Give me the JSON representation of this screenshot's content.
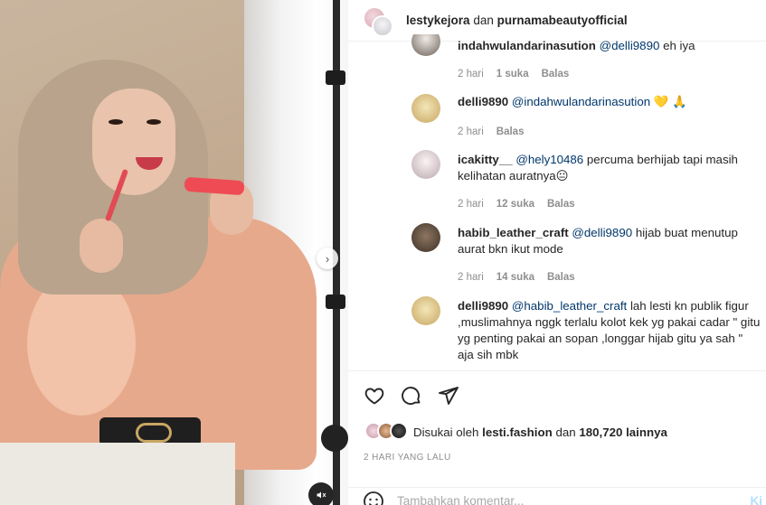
{
  "header": {
    "user1": "lestykejora",
    "conj": "dan",
    "user2": "purnamabeautyofficial"
  },
  "comments": [
    {
      "user": "indahwulandarinasution",
      "mention": "@delli9890",
      "text": "eh iya",
      "meta": {
        "time": "2 hari",
        "likes": "1 suka",
        "reply": "Balas"
      }
    },
    {
      "user": "delli9890",
      "mention": "@indahwulandarinasution",
      "text": "💛 🙏",
      "meta": {
        "time": "2 hari",
        "likes": "",
        "reply": "Balas"
      }
    },
    {
      "user": "icakitty__",
      "mention": "@hely10486",
      "text": "percuma berhijab tapi masih kelihatan auratnya😐",
      "meta": {
        "time": "2 hari",
        "likes": "12 suka",
        "reply": "Balas"
      }
    },
    {
      "user": "habib_leather_craft",
      "mention": "@delli9890",
      "text": "hijab buat menutup aurat bkn ikut mode",
      "meta": {
        "time": "2 hari",
        "likes": "14 suka",
        "reply": "Balas"
      }
    },
    {
      "user": "delli9890",
      "mention": "@habib_leather_craft",
      "text": "lah lesti kn publik figur ,muslimahnya nggk terlalu kolot kek yg pakai cadar \" gitu yg penting pakai an sopan ,longgar hijab gitu ya sah \" aja sih mbk",
      "meta": {
        "time": "",
        "likes": "",
        "reply": ""
      }
    }
  ],
  "likes": {
    "prefix": "Disukai oleh",
    "user": "lesti.fashion",
    "conj": "dan",
    "count": "180,720 lainnya"
  },
  "timestamp": "2 HARI YANG LALU",
  "add_comment": {
    "placeholder": "Tambahkan komentar...",
    "post_label": "Ki"
  },
  "colors": {
    "mention": "#00376b",
    "meta": "#8e8e8e",
    "border": "#efefef"
  },
  "icons": [
    "heart-icon",
    "comment-icon",
    "share-icon",
    "chevron-right-icon",
    "mute-icon",
    "emoji-icon"
  ]
}
